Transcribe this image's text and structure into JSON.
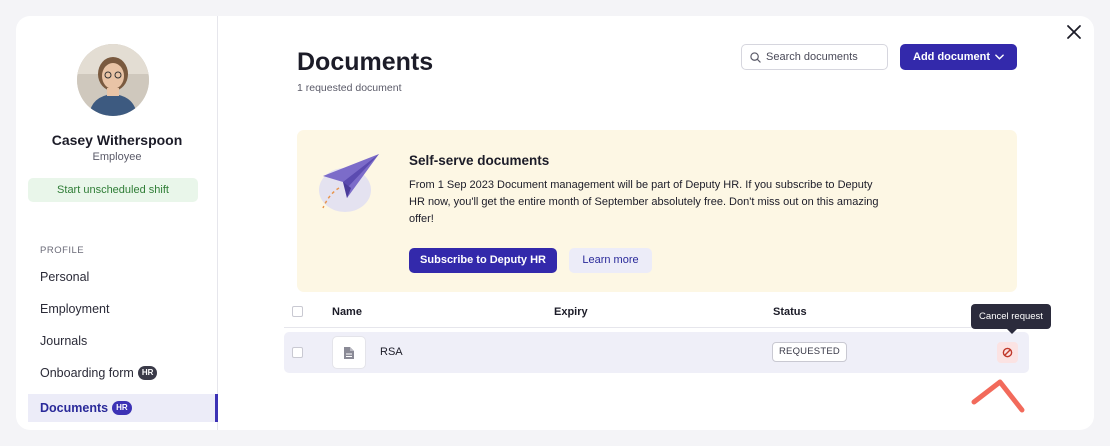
{
  "profile": {
    "name": "Casey Witherspoon",
    "role": "Employee",
    "shift_button": "Start unscheduled shift"
  },
  "sidebar": {
    "section_label": "PROFILE",
    "items": [
      {
        "label": "Personal",
        "badge": ""
      },
      {
        "label": "Employment",
        "badge": ""
      },
      {
        "label": "Journals",
        "badge": ""
      },
      {
        "label": "Onboarding form",
        "badge": "HR"
      },
      {
        "label": "Documents",
        "badge": "HR",
        "active": true
      }
    ]
  },
  "header": {
    "title": "Documents",
    "subtitle": "1 requested document",
    "search_placeholder": "Search documents",
    "add_button": "Add document"
  },
  "banner": {
    "title": "Self-serve documents",
    "text": "From 1 Sep 2023 Document management will be part of Deputy HR. If you subscribe to Deputy HR now, you'll get the entire month of September absolutely free. Don't miss out on this amazing offer!",
    "primary_button": "Subscribe to Deputy HR",
    "secondary_button": "Learn more"
  },
  "table": {
    "columns": [
      "Name",
      "Expiry",
      "Status"
    ],
    "rows": [
      {
        "name": "RSA",
        "expiry": "",
        "status": "REQUESTED"
      }
    ]
  },
  "tooltip": {
    "text": "Cancel request"
  },
  "colors": {
    "primary": "#3329ab",
    "shift_green": "#2f7d36",
    "banner_bg": "#fdf7e4",
    "cancel_red": "#c0392b",
    "annotation": "#f26a5b"
  },
  "icons": {
    "close": "close-icon",
    "search": "search-icon",
    "dropdown": "chevron-down-icon",
    "file": "file-icon",
    "cancel": "cancel-icon",
    "illustration": "paper-plane-illustration"
  }
}
